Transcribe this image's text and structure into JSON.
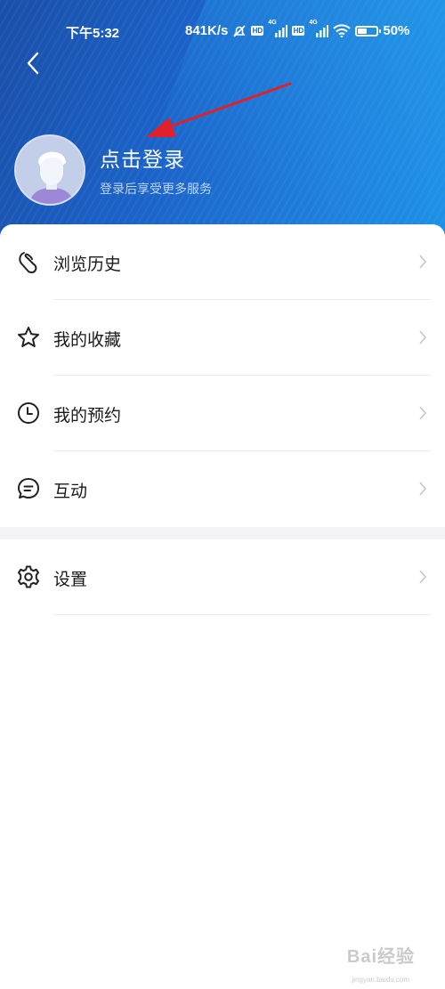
{
  "status_bar": {
    "time": "下午5:32",
    "net_speed": "841K/s",
    "sim1_type": "4G",
    "sim2_type": "4G",
    "hd": "HD",
    "battery": "50%",
    "battery_level": 0.5
  },
  "header": {
    "back_icon": "chevron-left-icon",
    "login_title": "点击登录",
    "login_subtitle": "登录后享受更多服务",
    "avatar_icon": "default-avatar",
    "annotation_color": "#e0202a"
  },
  "menu": {
    "items": [
      {
        "label": "浏览历史",
        "icon": "history-loop-icon"
      },
      {
        "label": "我的收藏",
        "icon": "star-icon"
      },
      {
        "label": "我的预约",
        "icon": "clock-icon"
      },
      {
        "label": "互动",
        "icon": "chat-bubble-icon"
      }
    ],
    "settings": {
      "label": "设置",
      "icon": "gear-icon"
    }
  },
  "watermark": {
    "text": "Bai经验",
    "url": "jingyan.baidu.com"
  },
  "colors": {
    "header_blue": "#1b63c9",
    "accent_light_blue": "#1f8fe6",
    "text_primary": "#1a1a1a",
    "divider": "#ececec"
  }
}
